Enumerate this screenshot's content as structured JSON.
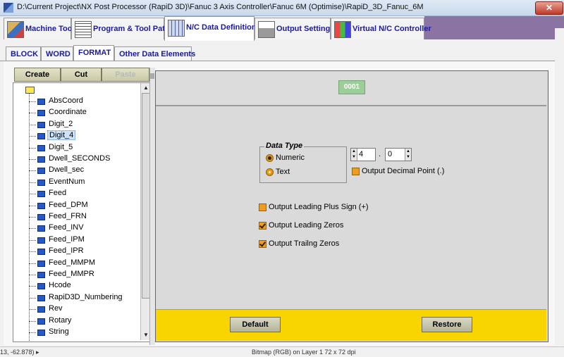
{
  "window": {
    "title": "D:\\Current Project\\NX Post Processor (RapiD 3D)\\Fanuc 3 Axis Controller\\Fanuc 6M (Optimise)\\RapiD_3D_Fanuc_6M",
    "close": "✕"
  },
  "main_tabs": [
    {
      "label": "Machine Tool",
      "icon": "machine-tool-icon"
    },
    {
      "label": "Program & Tool Path",
      "icon": "program-icon"
    },
    {
      "label": "N/C Data Definitions",
      "icon": "nc-data-icon"
    },
    {
      "label": "Output Settings",
      "icon": "printer-icon"
    },
    {
      "label": "Virtual N/C Controller",
      "icon": "controller-icon"
    }
  ],
  "sub_tabs": [
    {
      "label": "BLOCK"
    },
    {
      "label": "WORD"
    },
    {
      "label": "FORMAT"
    },
    {
      "label": "Other Data Elements"
    }
  ],
  "toolbar": {
    "create": "Create",
    "cut": "Cut",
    "paste": "Paste"
  },
  "tree": {
    "items": [
      "AbsCoord",
      "Coordinate",
      "Digit_2",
      "Digit_4",
      "Digit_5",
      "Dwell_SECONDS",
      "Dwell_sec",
      "EventNum",
      "Feed",
      "Feed_DPM",
      "Feed_FRN",
      "Feed_INV",
      "Feed_IPM",
      "Feed_IPR",
      "Feed_MMPM",
      "Feed_MMPR",
      "Hcode",
      "RapiD3D_Numbering",
      "Rev",
      "Rotary",
      "String"
    ],
    "selected": "Digit_4"
  },
  "preview": {
    "value": "0001"
  },
  "format": {
    "data_type_label": "Data Type",
    "numeric_label": "Numeric",
    "text_label": "Text",
    "selected_type": "Numeric",
    "integer_digits": "4",
    "separator": ".",
    "fraction_digits": "0",
    "output_decimal_point": "Output Decimal Point (.)",
    "leading_plus": "Output Leading Plus Sign (+)",
    "leading_zeros": "Output Leading Zeros",
    "trailing_zeros": "Output Trailng Zeros",
    "decimal_point_checked": false,
    "leading_plus_checked": false,
    "leading_zeros_checked": true,
    "trailing_zeros_checked": true
  },
  "buttons": {
    "default": "Default",
    "restore": "Restore"
  },
  "status": {
    "coords": "13, -62.878)  ▸",
    "info": "Bitmap (RGB) on Layer 1 72 x 72 dpi"
  },
  "colors": {
    "accent_yellow": "#f8d400",
    "tab_text": "#1a1aa0",
    "checkbox_orange": "#ee9d1c",
    "preview_green": "#9dcd9b"
  }
}
